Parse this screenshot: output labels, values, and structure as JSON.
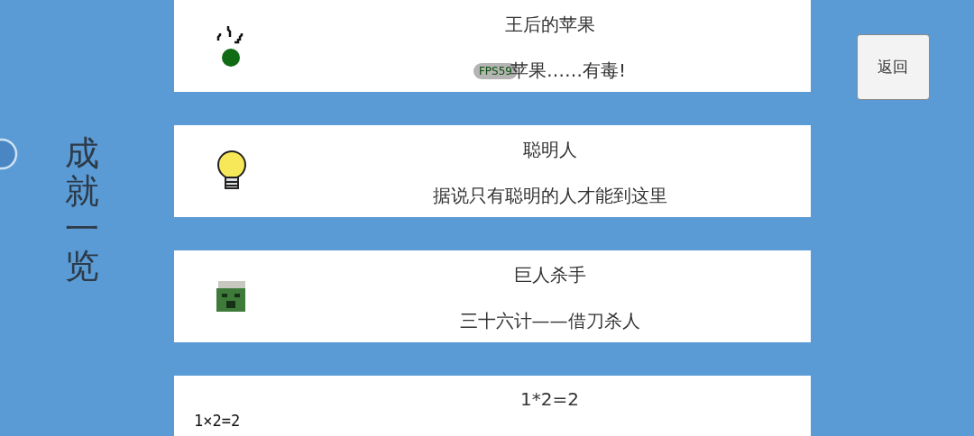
{
  "title": "成就一览",
  "back_button": "返回",
  "fps_badge": "FPS59",
  "achievements": [
    {
      "kind": "apple",
      "title": "王后的苹果",
      "description": "苹果……有毒!"
    },
    {
      "kind": "bulb",
      "title": "聪明人",
      "description": "据说只有聪明的人才能到这里"
    },
    {
      "kind": "head",
      "title": "巨人杀手",
      "description": "三十六计——借刀杀人"
    },
    {
      "kind": "text",
      "icon_text": "1×2=2",
      "title": "1*2=2"
    }
  ]
}
